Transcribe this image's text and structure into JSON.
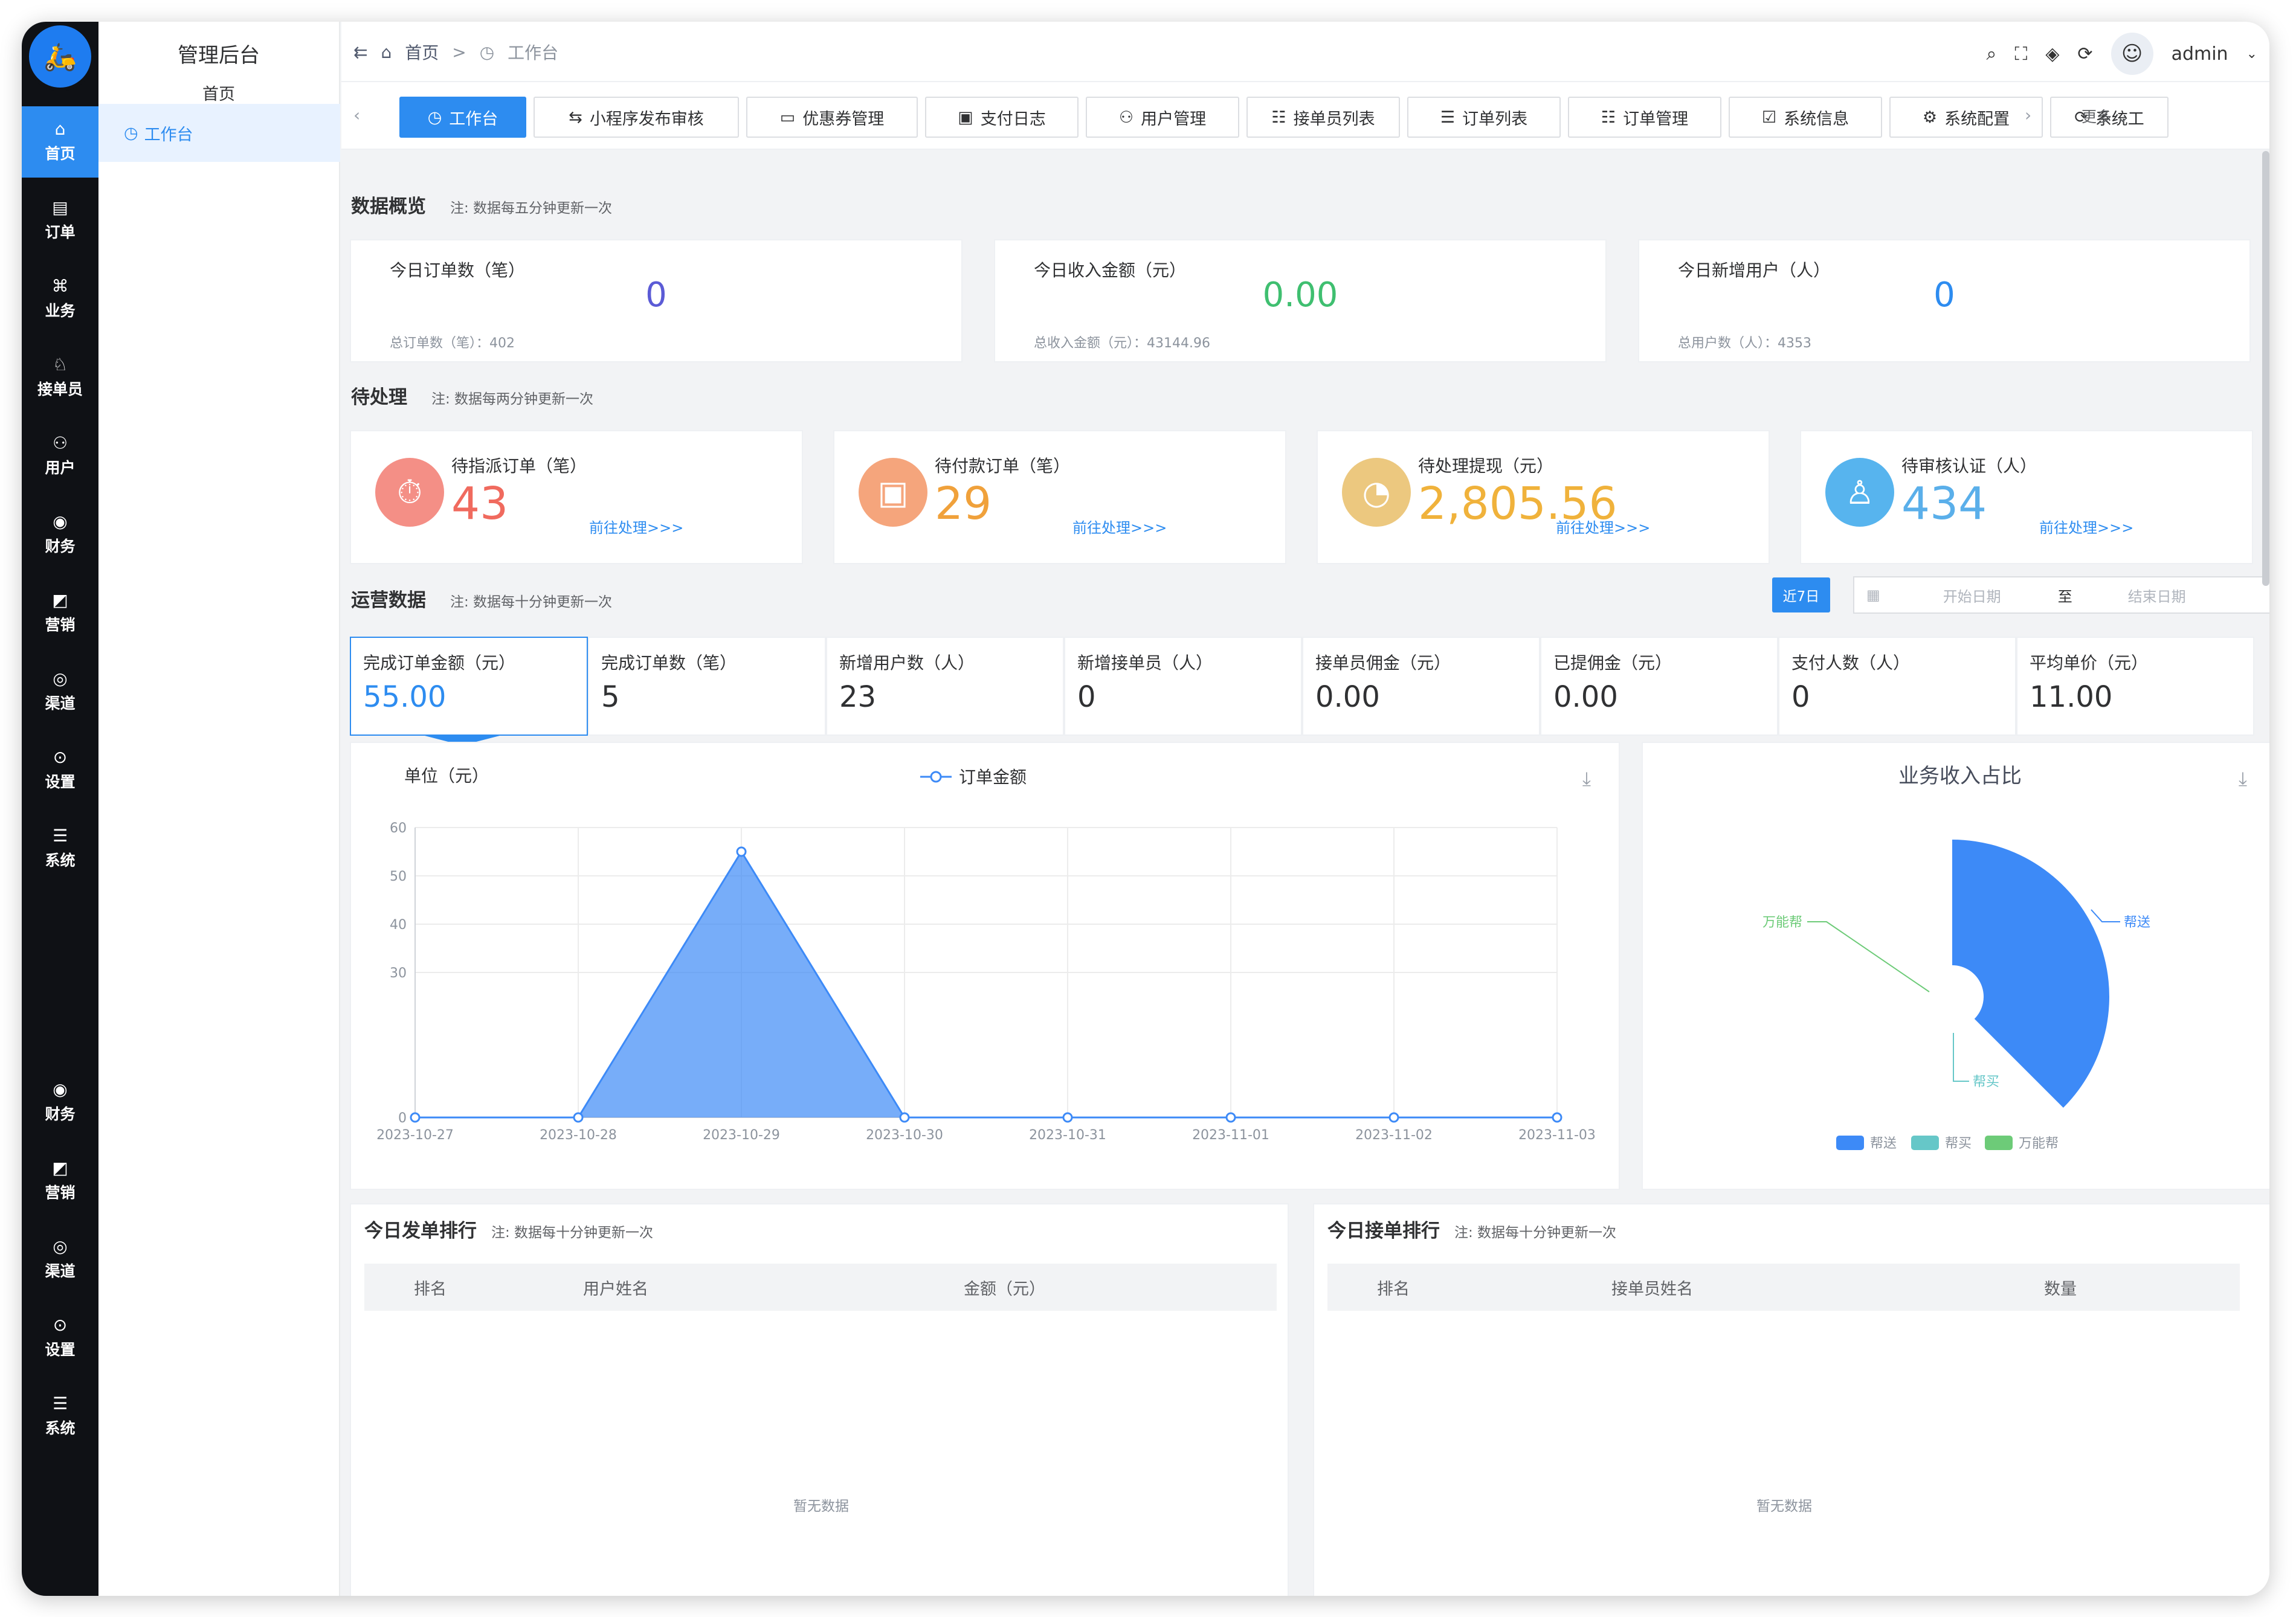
{
  "app": {
    "logo_text": "🛵",
    "title": "管理后台",
    "home": "首页",
    "workbench": "工作台",
    "user": "admin"
  },
  "rail": [
    {
      "label": "首页",
      "icon": "⌂",
      "active": true
    },
    {
      "label": "订单",
      "icon": "▤"
    },
    {
      "label": "业务",
      "icon": "⌘"
    },
    {
      "label": "接单员",
      "icon": "♘"
    },
    {
      "label": "用户",
      "icon": "⚇"
    },
    {
      "label": "财务",
      "icon": "◉"
    },
    {
      "label": "营销",
      "icon": "◩"
    },
    {
      "label": "渠道",
      "icon": "◎"
    },
    {
      "label": "设置",
      "icon": "⊙"
    },
    {
      "label": "系统",
      "icon": "☰"
    },
    {
      "label": "财务",
      "icon": "◉"
    },
    {
      "label": "营销",
      "icon": "◩"
    },
    {
      "label": "渠道",
      "icon": "◎"
    },
    {
      "label": "设置",
      "icon": "⊙"
    },
    {
      "label": "系统",
      "icon": "☰"
    }
  ],
  "breadcrumb": {
    "home": "首页",
    "sep": ">",
    "current": "工作台"
  },
  "tabs": [
    {
      "label": "工作台",
      "icon": "◷",
      "active": true
    },
    {
      "label": "小程序发布审核",
      "icon": "⇆"
    },
    {
      "label": "优惠券管理",
      "icon": "▭"
    },
    {
      "label": "支付日志",
      "icon": "▣"
    },
    {
      "label": "用户管理",
      "icon": "⚇"
    },
    {
      "label": "接单员列表",
      "icon": "☷"
    },
    {
      "label": "订单列表",
      "icon": "☰"
    },
    {
      "label": "订单管理",
      "icon": "☷"
    },
    {
      "label": "系统信息",
      "icon": "☑"
    },
    {
      "label": "系统配置",
      "icon": "⚙"
    },
    {
      "label": "系统工",
      "icon": "⟳"
    }
  ],
  "tabs_more": "更多",
  "overview": {
    "title": "数据概览",
    "note": "注: 数据每五分钟更新一次",
    "cards": [
      {
        "label": "今日订单数（笔）",
        "value": "0",
        "sub": "总订单数（笔）：402",
        "color": "#5b5bd6"
      },
      {
        "label": "今日收入金额（元）",
        "value": "0.00",
        "sub": "总收入金额（元）：43144.96",
        "color": "#3fbf70"
      },
      {
        "label": "今日新增用户（人）",
        "value": "0",
        "sub": "总用户数（人）：4353",
        "color": "#2d8cf0"
      }
    ]
  },
  "pending": {
    "title": "待处理",
    "note": "注: 数据每两分钟更新一次",
    "cards": [
      {
        "label": "待指派订单（笔）",
        "value": "43",
        "link": "前往处理>>>",
        "color": "#f06a5e",
        "icon": "⏱",
        "icon_bg": "#f48f86"
      },
      {
        "label": "待付款订单（笔）",
        "value": "29",
        "link": "前往处理>>>",
        "color": "#f0a13b",
        "icon": "▣",
        "icon_bg": "#f5a57c"
      },
      {
        "label": "待处理提现（元）",
        "value": "2,805.56",
        "link": "前往处理>>>",
        "color": "#f0b23b",
        "icon": "◔",
        "icon_bg": "#ecc87f"
      },
      {
        "label": "待审核认证（人）",
        "value": "434",
        "link": "前往处理>>>",
        "color": "#5aafea",
        "icon": "♙",
        "icon_bg": "#57b4ee"
      }
    ]
  },
  "operations": {
    "title": "运营数据",
    "note": "注: 数据每十分钟更新一次",
    "range_btn": "近7日",
    "start_placeholder": "开始日期",
    "to": "至",
    "end_placeholder": "结束日期",
    "stats": [
      {
        "label": "完成订单金额（元）",
        "value": "55.00",
        "selected": true
      },
      {
        "label": "完成订单数（笔）",
        "value": "5"
      },
      {
        "label": "新增用户数（人）",
        "value": "23"
      },
      {
        "label": "新增接单员（人）",
        "value": "0"
      },
      {
        "label": "接单员佣金（元）",
        "value": "0.00"
      },
      {
        "label": "已提佣金（元）",
        "value": "0.00"
      },
      {
        "label": "支付人数（人）",
        "value": "0"
      },
      {
        "label": "平均单价（元）",
        "value": "11.00"
      }
    ]
  },
  "chart_data": [
    {
      "type": "area",
      "ylabel": "单位（元）",
      "x": [
        "2023-10-27",
        "2023-10-28",
        "2023-10-29",
        "2023-10-30",
        "2023-10-31",
        "2023-11-01",
        "2023-11-02",
        "2023-11-03"
      ],
      "series": [
        {
          "name": "订单金额",
          "values": [
            0,
            0,
            55,
            0,
            0,
            0,
            0,
            0
          ]
        }
      ],
      "ylim": [
        0,
        60
      ],
      "yticks": [
        "0",
        "30",
        "40",
        "50",
        "60"
      ],
      "color": "#3d8af7",
      "grid": true,
      "legend": "top-center"
    },
    {
      "type": "pie",
      "title": "业务收入占比",
      "categories": [
        "帮送",
        "帮买",
        "万能帮"
      ],
      "values": [
        55,
        0,
        0
      ],
      "colors": [
        "#3d8af7",
        "#66c7c8",
        "#6dcb78"
      ],
      "legend": "bottom"
    }
  ],
  "rank_send": {
    "title": "今日发单排行",
    "note": "注: 数据每十分钟更新一次",
    "cols": [
      "排名",
      "用户姓名",
      "金额（元）"
    ],
    "empty": "暂无数据"
  },
  "rank_recv": {
    "title": "今日接单排行",
    "note": "注: 数据每十分钟更新一次",
    "cols": [
      "排名",
      "接单员姓名",
      "数量"
    ],
    "empty": "暂无数据"
  }
}
